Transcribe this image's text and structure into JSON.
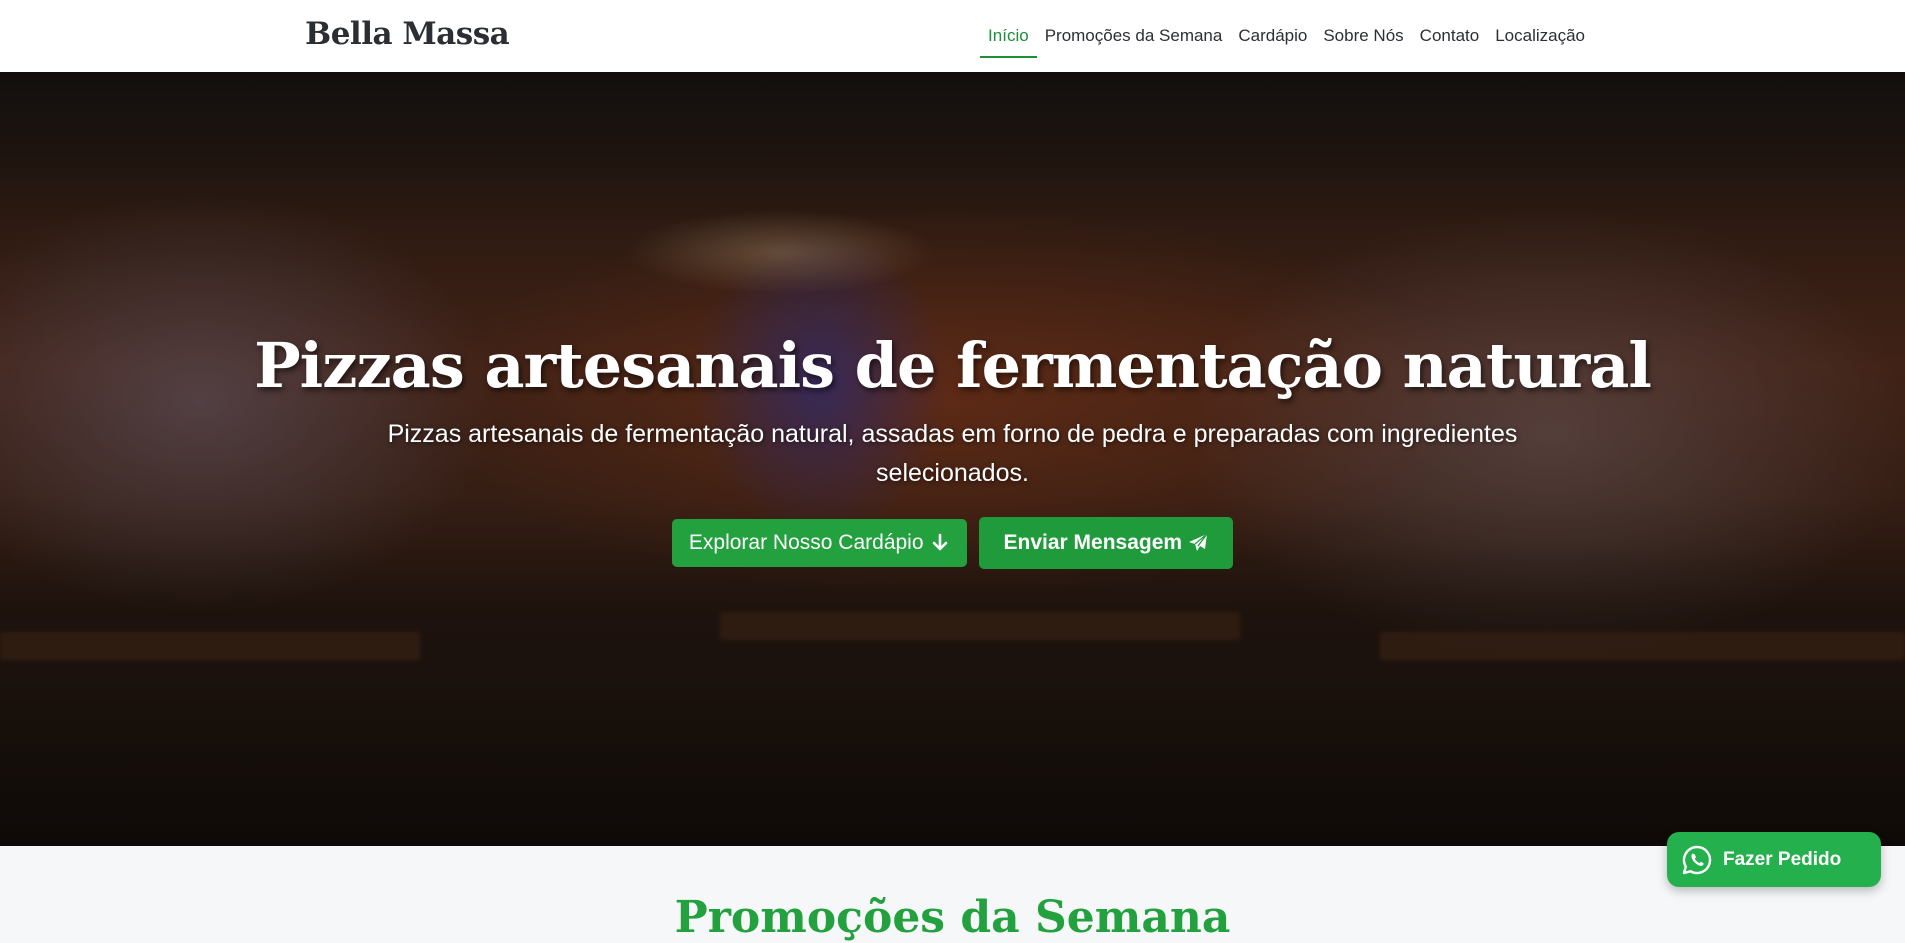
{
  "navbar": {
    "brand": "Bella Massa",
    "items": [
      {
        "label": "Início",
        "active": true
      },
      {
        "label": "Promoções da Semana",
        "active": false
      },
      {
        "label": "Cardápio",
        "active": false
      },
      {
        "label": "Sobre Nós",
        "active": false
      },
      {
        "label": "Contato",
        "active": false
      },
      {
        "label": "Localização",
        "active": false
      }
    ]
  },
  "hero": {
    "title": "Pizzas artesanais de fermentação natural",
    "subtitle": "Pizzas artesanais de fermentação natural, assadas em forno de pedra e preparadas com ingredientes selecionados.",
    "primary_button": {
      "label": "Explorar Nosso Cardápio",
      "icon": "arrow-down-icon"
    },
    "secondary_button": {
      "label": "Enviar Mensagem",
      "icon": "paper-plane-icon"
    }
  },
  "next_section": {
    "title": "Promoções da Semana"
  },
  "whatsapp_fab": {
    "label": "Fazer Pedido",
    "icon": "whatsapp-icon"
  },
  "colors": {
    "accent": "#23a13f",
    "accent_dark": "#1e8f39",
    "whatsapp": "#25b04e",
    "nav_text": "#2c2f33"
  }
}
